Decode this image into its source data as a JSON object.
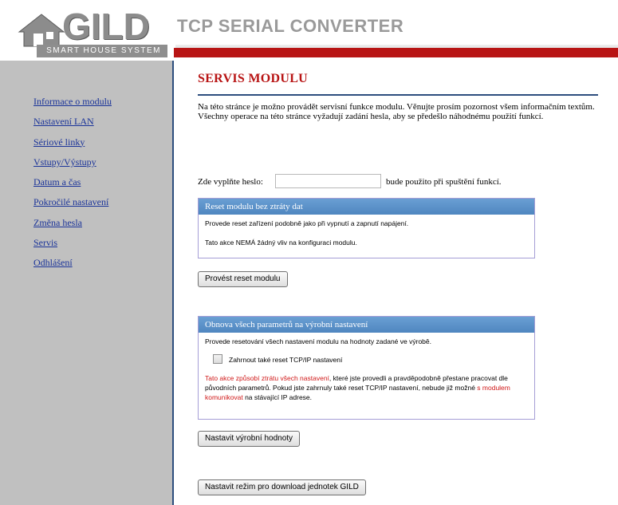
{
  "header": {
    "logo_text": "GILD",
    "logo_subtitle": "SMART HOUSE SYSTEM",
    "app_title": "TCP SERIAL CONVERTER"
  },
  "sidebar": {
    "items": [
      {
        "label": "Informace o modulu"
      },
      {
        "label": "Nastavení LAN"
      },
      {
        "label": "Sériové linky"
      },
      {
        "label": "Vstupy/Výstupy"
      },
      {
        "label": "Datum a čas"
      },
      {
        "label": "Pokročilé nastavení"
      },
      {
        "label": "Změna hesla"
      },
      {
        "label": "Servis"
      },
      {
        "label": "Odhlášení"
      }
    ]
  },
  "main": {
    "title": "SERVIS MODULU",
    "intro_1": "Na této stránce je možno provádět servisní funkce modulu. Věnujte prosím pozornost všem informačním textům.",
    "intro_2": "Všechny operace na této stránce vyžadují zadání hesla, aby se předešlo náhodnému použití funkcí.",
    "password": {
      "label": "Zde vyplňte heslo:",
      "value": "",
      "after": "bude použito při spuštění funkcí."
    },
    "reset_panel": {
      "title": "Reset modulu bez ztráty dat",
      "line1": "Provede reset zařízení podobně jako při vypnutí a zapnutí napájení.",
      "line2": "Tato akce NEMÁ žádný vliv na konfiguraci modulu.",
      "button": "Provést reset modulu"
    },
    "factory_panel": {
      "title": "Obnova všech parametrů na výrobní nastavení",
      "line1": "Provede resetování všech nastavení modulu na hodnoty zadané ve výrobě.",
      "checkbox_label": "Zahrnout také reset TCP/IP nastavení",
      "checkbox_checked": false,
      "warn_red1": "Tato akce způsobí ztrátu všech nastavení",
      "warn_text1": ", které jste provedli a pravděpodobně přestane pracovat dle původních parametrů. Pokud jste zahrnuly také reset TCP/IP nastavení, nebude již možné ",
      "warn_red2": "s modulem komunikovat",
      "warn_text2": " na stávající IP adrese.",
      "button": "Nastavit výrobní hodnoty"
    },
    "download_button": "Nastavit režim pro download jednotek GILD"
  },
  "colors": {
    "accent_red": "#b81414",
    "panel_header_blue": "#5a8fc8",
    "sidebar_bg": "#c0c0c0",
    "link_blue": "#1a3399"
  }
}
